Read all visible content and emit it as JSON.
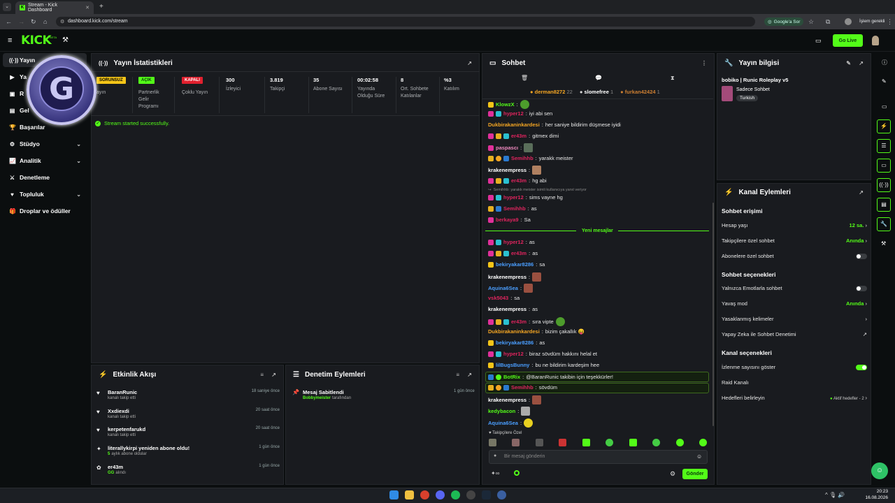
{
  "browser": {
    "tab_title": "Stream - Kick Dashboard",
    "url": "dashboard.kick.com/stream",
    "google_ask": "Google'a Sor",
    "profile_label": "İşlem gerekli"
  },
  "header": {
    "logo": "KICK",
    "beta": "BETA",
    "go_live": "Go Live"
  },
  "sidebar": {
    "items": [
      {
        "label": "Yayın",
        "icon": "stream-icon",
        "active": true
      },
      {
        "label": "Ya",
        "icon": "video-icon"
      },
      {
        "label": "R",
        "icon": "record-icon"
      },
      {
        "label": "Gel",
        "icon": "revenue-icon"
      },
      {
        "label": "Başarılar",
        "icon": "trophy-icon"
      },
      {
        "label": "Stüdyo",
        "icon": "studio-icon",
        "chevron": true
      },
      {
        "label": "Analitik",
        "icon": "analytics-icon",
        "chevron": true
      },
      {
        "label": "Denetleme",
        "icon": "moderation-icon"
      },
      {
        "label": "Topluluk",
        "icon": "community-icon",
        "chevron": true
      },
      {
        "label": "Droplar ve ödüller",
        "icon": "drops-icon"
      }
    ],
    "overlay_letter": "G"
  },
  "stats": {
    "title": "Yayın İstatistikleri",
    "items": [
      {
        "badge": "SORUNSUZ",
        "label": "ayın",
        "badge_color": "#f5c518"
      },
      {
        "badge": "AÇIK",
        "label": "Partnerlik Gelir Programı",
        "badge_color": "#53fc18"
      },
      {
        "badge": "KAPALI",
        "label": "Çoklu Yayın",
        "badge_color": "#e0202e"
      },
      {
        "value": "300",
        "label": "İzleyici"
      },
      {
        "value": "3.819",
        "label": "Takipçi"
      },
      {
        "value": "35",
        "label": "Abone Sayısı"
      },
      {
        "value": "00:02:58",
        "label": "Yayında Olduğu Süre"
      },
      {
        "value": "8",
        "label": "Ort. Sohbete Katılanlar"
      },
      {
        "value": "%3",
        "label": "Katılım"
      }
    ],
    "status": "Stream started successfully."
  },
  "activity": {
    "title": "Etkinlik Akışı",
    "items": [
      {
        "name": "BaranRunic",
        "sub": "kanalı takip etti",
        "time": "18 saniye önce",
        "icon": "heart-icon"
      },
      {
        "name": "Xxdiexdi",
        "sub": "kanalı takip etti",
        "time": "20 saat önce",
        "icon": "heart-icon"
      },
      {
        "name": "kerpetenfarukd",
        "sub": "kanalı takip etti",
        "time": "20 saat önce",
        "icon": "heart-icon"
      },
      {
        "name": "literallykirpi yeniden abone oldu!",
        "sub": "aylık abone oldular",
        "sub_prefix": "5",
        "time": "1 gün önce",
        "icon": "star-icon"
      },
      {
        "name": "er43m",
        "sub": "alındı",
        "sub_prefix": "GG",
        "time": "1 gün önce",
        "icon": "gift-icon"
      }
    ]
  },
  "moderation": {
    "title": "Denetim Eylemleri",
    "item": {
      "title": "Mesaj Sabitlendi",
      "user": "Bobbymeister",
      "suffix": "tarafından",
      "time": "1 gün önce"
    }
  },
  "chat": {
    "title": "Sohbet",
    "leaders": [
      {
        "name": "derman8272",
        "count": "22"
      },
      {
        "name": "slomefree",
        "count": "1"
      },
      {
        "name": "furkan42424",
        "count": "1"
      }
    ],
    "messages": [
      {
        "user": "KlowzX",
        "color": "#53fc18",
        "text": "",
        "emote": true
      },
      {
        "user": "hyper12",
        "color": "#e0245e",
        "text": "iyi abi sen"
      },
      {
        "user": "Dukbirakaninkardesi",
        "color": "#f5a623",
        "text": "her saniye bildirim düşmese iyidi"
      },
      {
        "user": "er43m",
        "color": "#e0245e",
        "text": "gitmex dimi"
      },
      {
        "user": "paspascı",
        "color": "#f08ac0",
        "text": "",
        "emote": true
      },
      {
        "user": "Semihhb",
        "color": "#e0245e",
        "text": "yarakk meister"
      },
      {
        "user": "krakenempress",
        "color": "#fff",
        "text": "",
        "emote": true
      },
      {
        "user": "er43m",
        "color": "#e0245e",
        "text": "hg abi"
      },
      {
        "user": "hyper12",
        "color": "#e0245e",
        "text": "sims vayne hg",
        "reply": "Semihhb: yarakk meister isimli kullanıcıya yanıt veriyor"
      },
      {
        "user": "Semihhb",
        "color": "#e0245e",
        "text": "as"
      },
      {
        "user": "berkaya9",
        "color": "#e0245e",
        "text": "Sa"
      },
      {
        "user": "hyper12",
        "color": "#e0245e",
        "text": "as"
      },
      {
        "user": "er43m",
        "color": "#e0245e",
        "text": "as"
      },
      {
        "user": "bekiryakar8286",
        "color": "#4a9eff",
        "text": "sa"
      },
      {
        "user": "krakenempress",
        "color": "#fff",
        "text": "",
        "emote": true
      },
      {
        "user": "Aquina6Sea",
        "color": "#4a9eff",
        "text": "",
        "emote": true
      },
      {
        "user": "vsk5043",
        "color": "#e0245e",
        "text": "sa"
      },
      {
        "user": "krakenempress",
        "color": "#fff",
        "text": "as"
      },
      {
        "user": "er43m",
        "color": "#e0245e",
        "text": "sıra vipte",
        "emote": true
      },
      {
        "user": "Dukbirakaninkardesi",
        "color": "#f5a623",
        "text": "bizim çakallık 😝"
      },
      {
        "user": "bekiryakar8286",
        "color": "#4a9eff",
        "text": "as"
      },
      {
        "user": "hyper12",
        "color": "#e0245e",
        "text": "biraz sövdüm hakkını helal et"
      },
      {
        "user": "lilBugsBunny",
        "color": "#4a9eff",
        "text": "bu ne bildirim kardeşim hee"
      },
      {
        "user": "BotRix",
        "color": "#53fc18",
        "text": "@BaranRunic takibin için teşekkürler!",
        "highlight": true
      },
      {
        "user": "Semihhb",
        "color": "#e0245e",
        "text": "sövdüm",
        "highlight": true
      },
      {
        "user": "krakenempress",
        "color": "#fff",
        "text": "",
        "emote": true
      },
      {
        "user": "kedybacon",
        "color": "#53fc18",
        "text": "",
        "emote": true
      },
      {
        "user": "Aquina6Sea",
        "color": "#4a9eff",
        "text": "",
        "emote": true
      }
    ],
    "new_messages": "Yeni mesajlar",
    "followers_only": "Takipçilere Özel",
    "input_placeholder": "Bir mesaj gönderin",
    "send": "Gönder"
  },
  "stream_info": {
    "title": "Yayın bilgisi",
    "stream_title": "bobiko | Runic Roleplay v5",
    "category": "Sadece Sohbet",
    "tag": "Turkish"
  },
  "channel_actions": {
    "title": "Kanal Eylemleri",
    "chat_access": "Sohbet erişimi",
    "rows1": [
      {
        "label": "Hesap yaşı",
        "value": "12 sa."
      },
      {
        "label": "Takipçilere özel sohbet",
        "value": "Anında"
      },
      {
        "label": "Abonelere özel sohbet",
        "toggle": false
      }
    ],
    "chat_options": "Sohbet seçenekleri",
    "rows2": [
      {
        "label": "Yalnızca Emotlarla sohbet",
        "toggle": false
      },
      {
        "label": "Yavaş mod",
        "value": "Anında"
      },
      {
        "label": "Yasaklanmış kelimeler"
      },
      {
        "label": "Yapay Zeka ile Sohbet Denetimi"
      }
    ],
    "channel_options": "Kanal seçenekleri",
    "rows3": [
      {
        "label": "İzlenme sayısını göster",
        "toggle": true
      },
      {
        "label": "Raid Kanalı"
      },
      {
        "label": "Hedefleri belirleyin",
        "value": "Aktif hedefler - 2"
      }
    ]
  },
  "taskbar": {
    "time": "20:23",
    "date": "16.08.2026"
  }
}
